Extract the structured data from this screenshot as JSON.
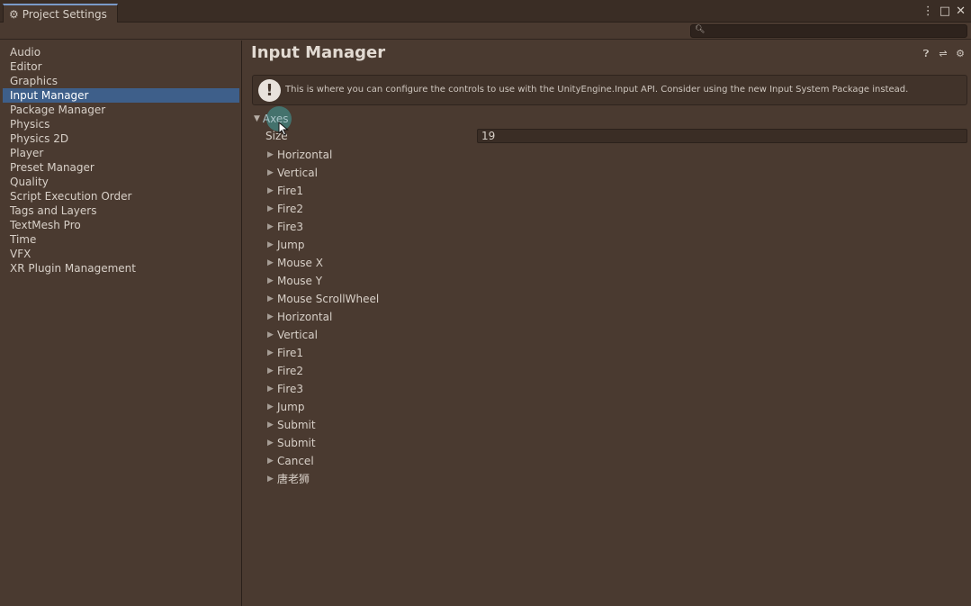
{
  "window": {
    "tab_title": "Project Settings",
    "controls": [
      "⋮",
      "□",
      "✕"
    ]
  },
  "search": {
    "placeholder": ""
  },
  "sidebar": {
    "items": [
      {
        "label": "Audio",
        "selected": false
      },
      {
        "label": "Editor",
        "selected": false
      },
      {
        "label": "Graphics",
        "selected": false
      },
      {
        "label": "Input Manager",
        "selected": true
      },
      {
        "label": "Package Manager",
        "selected": false
      },
      {
        "label": "Physics",
        "selected": false
      },
      {
        "label": "Physics 2D",
        "selected": false
      },
      {
        "label": "Player",
        "selected": false
      },
      {
        "label": "Preset Manager",
        "selected": false
      },
      {
        "label": "Quality",
        "selected": false
      },
      {
        "label": "Script Execution Order",
        "selected": false
      },
      {
        "label": "Tags and Layers",
        "selected": false
      },
      {
        "label": "TextMesh Pro",
        "selected": false
      },
      {
        "label": "Time",
        "selected": false
      },
      {
        "label": "VFX",
        "selected": false
      },
      {
        "label": "XR Plugin Management",
        "selected": false
      }
    ]
  },
  "main": {
    "title": "Input Manager",
    "info_text": "This is where you can configure the controls to use with the UnityEngine.Input API. Consider using the new Input System Package instead.",
    "axes_label": "Axes",
    "size_label": "Size",
    "size_value": "19",
    "axes": [
      "Horizontal",
      "Vertical",
      "Fire1",
      "Fire2",
      "Fire3",
      "Jump",
      "Mouse X",
      "Mouse Y",
      "Mouse ScrollWheel",
      "Horizontal",
      "Vertical",
      "Fire1",
      "Fire2",
      "Fire3",
      "Jump",
      "Submit",
      "Submit",
      "Cancel",
      "唐老狮"
    ]
  },
  "colors": {
    "background": "#4a3a30",
    "selection": "#3e5f8a",
    "highlight": "#40a0a0"
  }
}
